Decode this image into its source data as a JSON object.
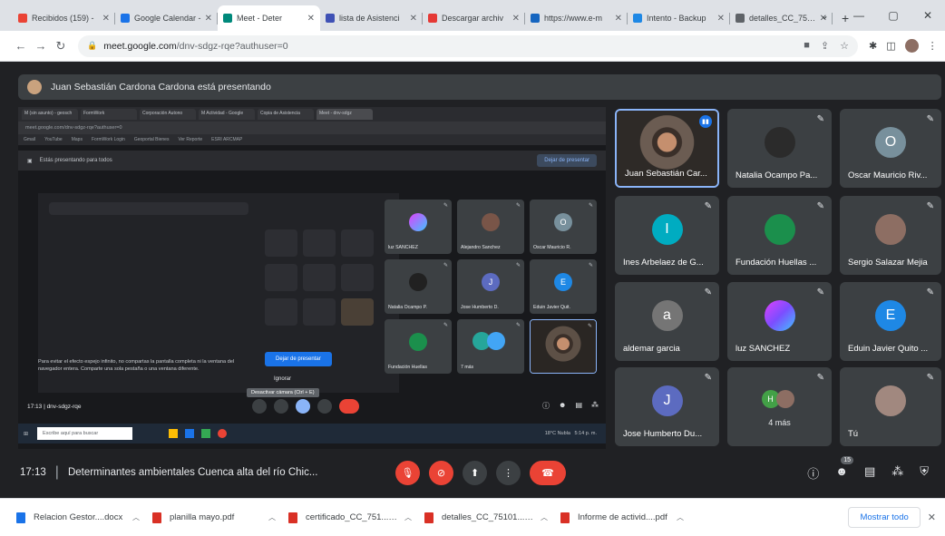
{
  "browser": {
    "tabs": [
      {
        "label": "Recibidos (159) -",
        "color": "#ea4335"
      },
      {
        "label": "Google Calendar -",
        "color": "#1a73e8"
      },
      {
        "label": "Meet - Deter",
        "color": "#00897b"
      },
      {
        "label": "lista de Asistenci",
        "color": "#3f51b5"
      },
      {
        "label": "Descargar archiv",
        "color": "#e53935"
      },
      {
        "label": "https://www.e-m",
        "color": "#1565c0"
      },
      {
        "label": "Intento - Backup",
        "color": "#1e88e5"
      },
      {
        "label": "detalles_CC_7510",
        "color": "#5f6368"
      }
    ],
    "url_host": "meet.google.com",
    "url_path": "/dnv-sdgz-rqe?authuser=0"
  },
  "banner": {
    "text": "Juan Sebastián Cardona Cardona está presentando"
  },
  "shared_screen": {
    "tabs": [
      "M (sin asunto) - geosch",
      "FormWork",
      "Corporación Autono",
      "M Actividad - Google",
      "Copia de Asistencia",
      "Meet - dnv-sdgz"
    ],
    "address": "meet.google.com/dnv-sdgz-rqe?authuser=0",
    "bookmarks": [
      "Gmail",
      "YouTube",
      "Maps",
      "FormWork Login",
      "Geoportal Bienes",
      "Ver Reporte",
      "ESRI ARCMAP"
    ],
    "presenting_label": "Estás presentando para todos",
    "stop_link": "Dejar de presentar",
    "hint": "Para evitar el efecto espejo infinito, no compartas la pantalla completa ni la ventana del navegador entera. Comparte una sola pestaña o una ventana diferente.",
    "stop_button": "Dejar de presentar",
    "ignore": "Ignorar",
    "tooltip": "Desactivar cámara (Ctrl + E)",
    "time_code": "17:13  |  dnv-sdgz-rqe",
    "search_placeholder": "Escribe aquí para buscar",
    "weather": "18°C Nubla",
    "clock": "5:14 p. m.",
    "grid": [
      {
        "name": "luz SANCHEZ",
        "kind": "luz",
        "color": "#e040fb",
        "initial": ""
      },
      {
        "name": "Alejandro Sanchez",
        "kind": "photo",
        "color": "#795548",
        "initial": ""
      },
      {
        "name": "Oscar Mauricio R.",
        "kind": "initial",
        "color": "#78909c",
        "initial": "O"
      },
      {
        "name": "Natalia Ocampo P.",
        "kind": "photo",
        "color": "#212121",
        "initial": ""
      },
      {
        "name": "Jose Humberto D.",
        "kind": "initial",
        "color": "#5c6bc0",
        "initial": "J"
      },
      {
        "name": "Eduin Javier Quit.",
        "kind": "initial",
        "color": "#1e88e5",
        "initial": "E"
      },
      {
        "name": "Fundación Huellas",
        "kind": "photo",
        "color": "#1b8f4c",
        "initial": ""
      },
      {
        "name": "7 más",
        "kind": "multi",
        "color": "#26a69a",
        "initial": ""
      },
      {
        "name": "",
        "kind": "self",
        "color": "#5d4037",
        "initial": ""
      }
    ]
  },
  "participants": [
    {
      "name": "Juan Sebastián Car...",
      "initial": "",
      "color": "#5d4037",
      "kind": "speaker"
    },
    {
      "name": "Natalia Ocampo Pa...",
      "initial": "",
      "color": "#2b2b2b",
      "kind": "photo"
    },
    {
      "name": "Oscar Mauricio Riv...",
      "initial": "O",
      "color": "#78909c",
      "kind": "initial"
    },
    {
      "name": "Ines Arbelaez de G...",
      "initial": "I",
      "color": "#00acc1",
      "kind": "initial"
    },
    {
      "name": "Fundación Huellas ...",
      "initial": "",
      "color": "#1b8f4c",
      "kind": "photo"
    },
    {
      "name": "Sergio Salazar Mejia",
      "initial": "",
      "color": "#8d6e63",
      "kind": "photo"
    },
    {
      "name": "aldemar garcia",
      "initial": "a",
      "color": "#757575",
      "kind": "initial"
    },
    {
      "name": "luz SANCHEZ",
      "initial": "",
      "color": "#e040fb",
      "kind": "luz"
    },
    {
      "name": "Eduin Javier Quito ...",
      "initial": "E",
      "color": "#1e88e5",
      "kind": "initial"
    },
    {
      "name": "Jose Humberto Du...",
      "initial": "J",
      "color": "#5c6bc0",
      "kind": "initial"
    },
    {
      "name": "4 más",
      "initial": "",
      "color": "#43a047",
      "kind": "multi"
    },
    {
      "name": "Tú",
      "initial": "",
      "color": "#a1887f",
      "kind": "photo"
    }
  ],
  "meeting": {
    "time": "17:13",
    "title": "Determinantes ambientales Cuenca alta del río Chic...",
    "participants_count": "15"
  },
  "downloads": [
    {
      "name": "Relacion Gestor....docx",
      "type": "doc"
    },
    {
      "name": "planilla mayo.pdf",
      "type": "pdf"
    },
    {
      "name": "certificado_CC_751....pdf",
      "type": "pdf"
    },
    {
      "name": "detalles_CC_75101....pdf",
      "type": "pdf"
    },
    {
      "name": "Informe de activid....pdf",
      "type": "pdf"
    }
  ],
  "show_all": "Mostrar todo"
}
